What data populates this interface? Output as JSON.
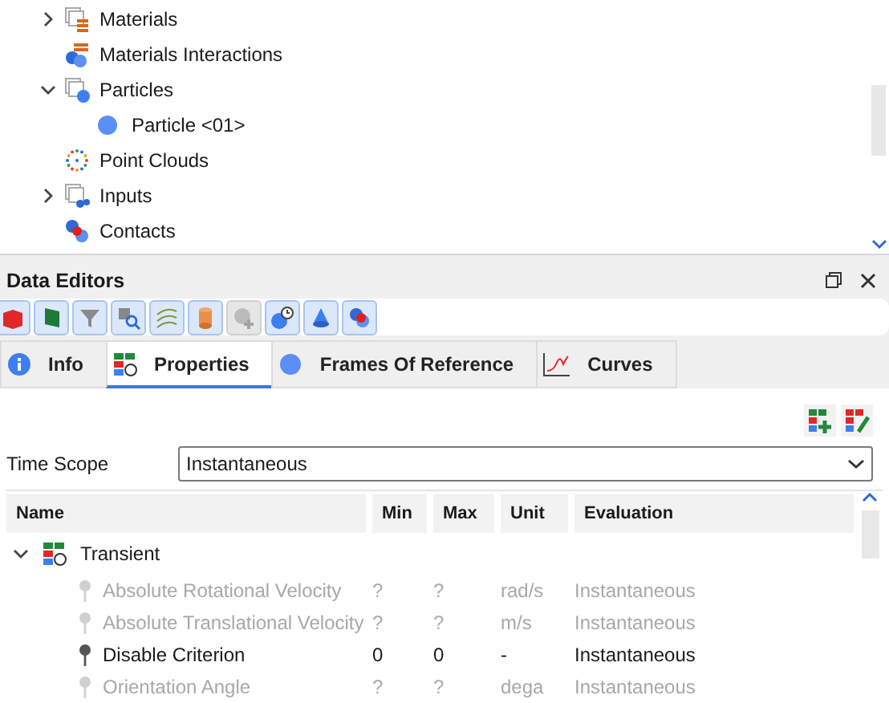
{
  "tree": {
    "items": [
      {
        "label": "Materials",
        "expanded": false
      },
      {
        "label": "Materials Interactions"
      },
      {
        "label": "Particles",
        "expanded": true,
        "children": [
          {
            "label": "Particle <01>"
          }
        ]
      },
      {
        "label": "Point Clouds"
      },
      {
        "label": "Inputs",
        "expanded": false
      },
      {
        "label": "Contacts"
      }
    ]
  },
  "panel": {
    "title": "Data Editors"
  },
  "toolbar": [
    {
      "disabled": false
    },
    {
      "disabled": false
    },
    {
      "disabled": false
    },
    {
      "disabled": false
    },
    {
      "disabled": false
    },
    {
      "disabled": false
    },
    {
      "disabled": true
    },
    {
      "disabled": false
    },
    {
      "disabled": false
    },
    {
      "disabled": false
    }
  ],
  "tabs": [
    {
      "label": "Info",
      "selected": false
    },
    {
      "label": "Properties",
      "selected": true
    },
    {
      "label": "Frames Of Reference",
      "selected": false
    },
    {
      "label": "Curves",
      "selected": false
    }
  ],
  "time_scope": {
    "label": "Time Scope",
    "value": "Instantaneous"
  },
  "table": {
    "columns": [
      "Name",
      "Min",
      "Max",
      "Unit",
      "Evaluation"
    ],
    "group": {
      "label": "Transient",
      "expanded": true
    },
    "rows": [
      {
        "name": "Absolute Rotational Velocity",
        "min": "?",
        "max": "?",
        "unit": "rad/s",
        "evaluation": "Instantaneous",
        "disabled": true
      },
      {
        "name": "Absolute Translational Velocity",
        "min": "?",
        "max": "?",
        "unit": "m/s",
        "evaluation": "Instantaneous",
        "disabled": true
      },
      {
        "name": "Disable Criterion",
        "min": "0",
        "max": "0",
        "unit": "-",
        "evaluation": "Instantaneous",
        "disabled": false
      },
      {
        "name": "Orientation Angle",
        "min": "?",
        "max": "?",
        "unit": "dega",
        "evaluation": "Instantaneous",
        "disabled": true
      }
    ]
  }
}
